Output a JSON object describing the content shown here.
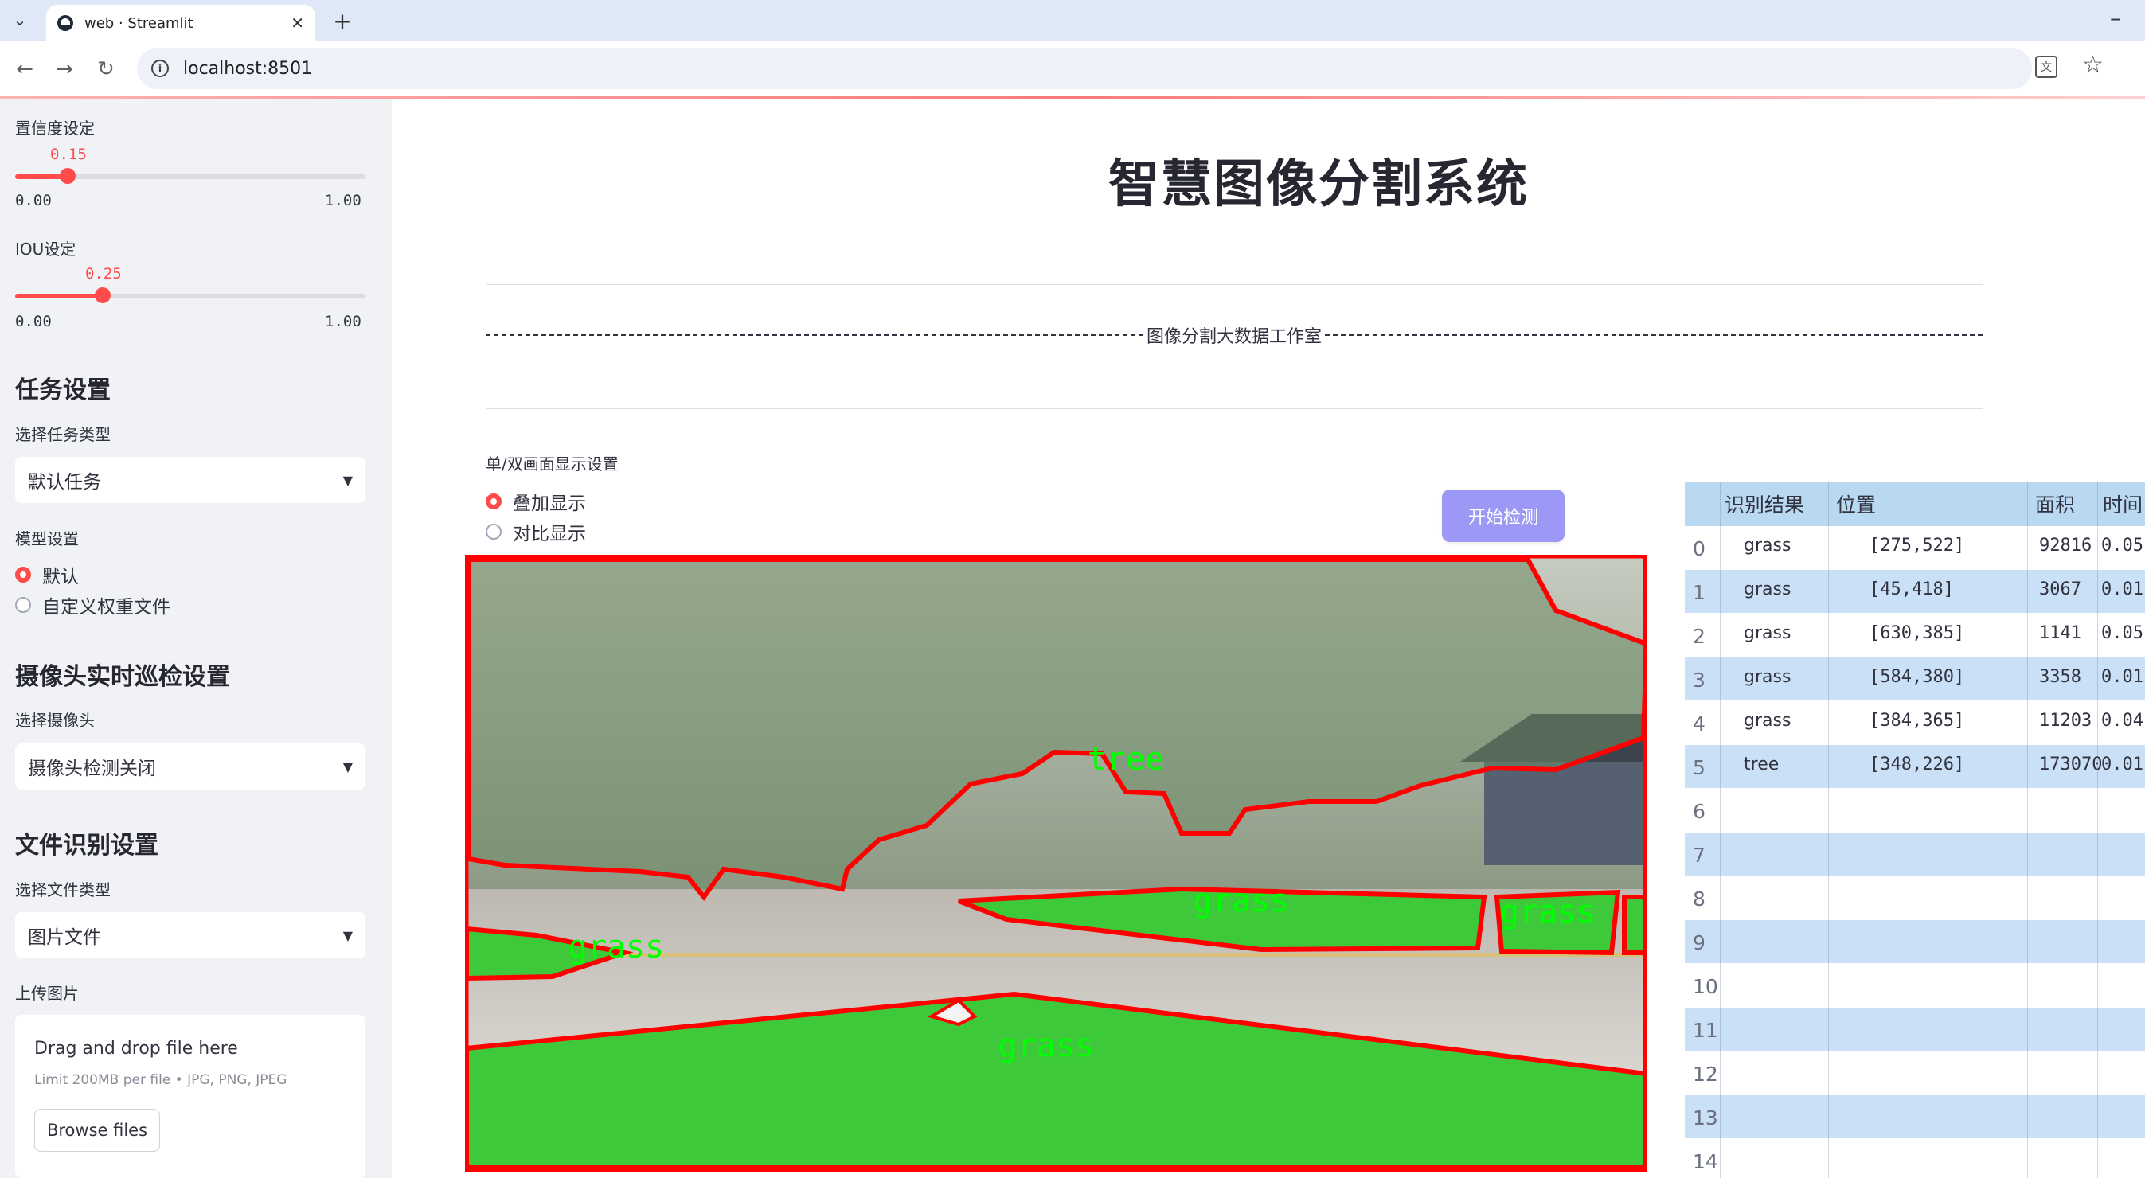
{
  "browser": {
    "tab_title": "web · Streamlit",
    "url": "localhost:8501"
  },
  "sidebar": {
    "confidence": {
      "label": "置信度设定",
      "value": "0.15",
      "value_num": 0.15,
      "min": "0.00",
      "max": "1.00"
    },
    "iou": {
      "label": "IOU设定",
      "value": "0.25",
      "value_num": 0.25,
      "min": "0.00",
      "max": "1.00"
    },
    "task_section": "任务设置",
    "task_type_label": "选择任务类型",
    "task_type_value": "默认任务",
    "model_label": "模型设置",
    "model_options": [
      "默认",
      "自定义权重文件"
    ],
    "camera_section": "摄像头实时巡检设置",
    "camera_label": "选择摄像头",
    "camera_value": "摄像头检测关闭",
    "file_section": "文件识别设置",
    "file_type_label": "选择文件类型",
    "file_type_value": "图片文件",
    "upload_label": "上传图片",
    "uploader": {
      "title": "Drag and drop file here",
      "limit": "Limit 200MB per file • JPG, PNG, JPEG",
      "button": "Browse files"
    }
  },
  "main": {
    "title": "智慧图像分割系统",
    "banner": "图像分割大数据工作室",
    "display_mode_label": "单/双画面显示设置",
    "display_options": [
      "叠加显示",
      "对比显示"
    ],
    "detect_button": "开始检测",
    "segment_labels": [
      "tree",
      "grass",
      "grass",
      "grass",
      "grass"
    ]
  },
  "table": {
    "headers": [
      "识别结果",
      "位置",
      "面积",
      "时间"
    ],
    "rows": [
      {
        "idx": "0",
        "label": "grass",
        "pos": "[275,522]",
        "area": "92816",
        "time": "0.05"
      },
      {
        "idx": "1",
        "label": "grass",
        "pos": "[45,418]",
        "area": "3067",
        "time": "0.01"
      },
      {
        "idx": "2",
        "label": "grass",
        "pos": "[630,385]",
        "area": "1141",
        "time": "0.05"
      },
      {
        "idx": "3",
        "label": "grass",
        "pos": "[584,380]",
        "area": "3358",
        "time": "0.01"
      },
      {
        "idx": "4",
        "label": "grass",
        "pos": "[384,365]",
        "area": "11203",
        "time": "0.04"
      },
      {
        "idx": "5",
        "label": "tree",
        "pos": "[348,226]",
        "area": "173070",
        "time": "0.01"
      },
      {
        "idx": "6"
      },
      {
        "idx": "7"
      },
      {
        "idx": "8"
      },
      {
        "idx": "9"
      },
      {
        "idx": "10"
      },
      {
        "idx": "11"
      },
      {
        "idx": "12"
      },
      {
        "idx": "13"
      },
      {
        "idx": "14"
      }
    ]
  },
  "colors": {
    "accent": "#ff4b4b",
    "sidebar_bg": "#f0f2f6",
    "button_bg": "#9c98f6",
    "table_header": "#b9d8f2",
    "table_alt": "#c9e0f6",
    "mask_green": "#3ec93a",
    "outline_red": "#ff0000"
  }
}
